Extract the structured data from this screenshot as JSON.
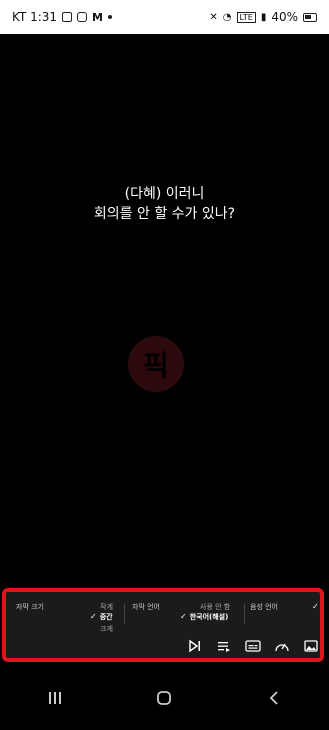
{
  "status": {
    "carrier_time": "KT 1:31",
    "battery": "40%"
  },
  "subtitle": {
    "line1": "(다혜) 이러니",
    "line2": "회의를 안 할 수가 있나?"
  },
  "watermark": {
    "text": "픽"
  },
  "panel": {
    "subtitle_size": {
      "label": "자막 크기",
      "options": [
        "작게",
        "중간",
        "크게"
      ],
      "selected": "중간"
    },
    "subtitle_language": {
      "label": "자막 언어",
      "options": [
        "사용 안 함",
        "한국어(해설)"
      ],
      "selected": "한국어(해설)"
    },
    "audio_language": {
      "label": "음성 언어"
    }
  },
  "colors": {
    "highlight_border": "#e1131b"
  }
}
